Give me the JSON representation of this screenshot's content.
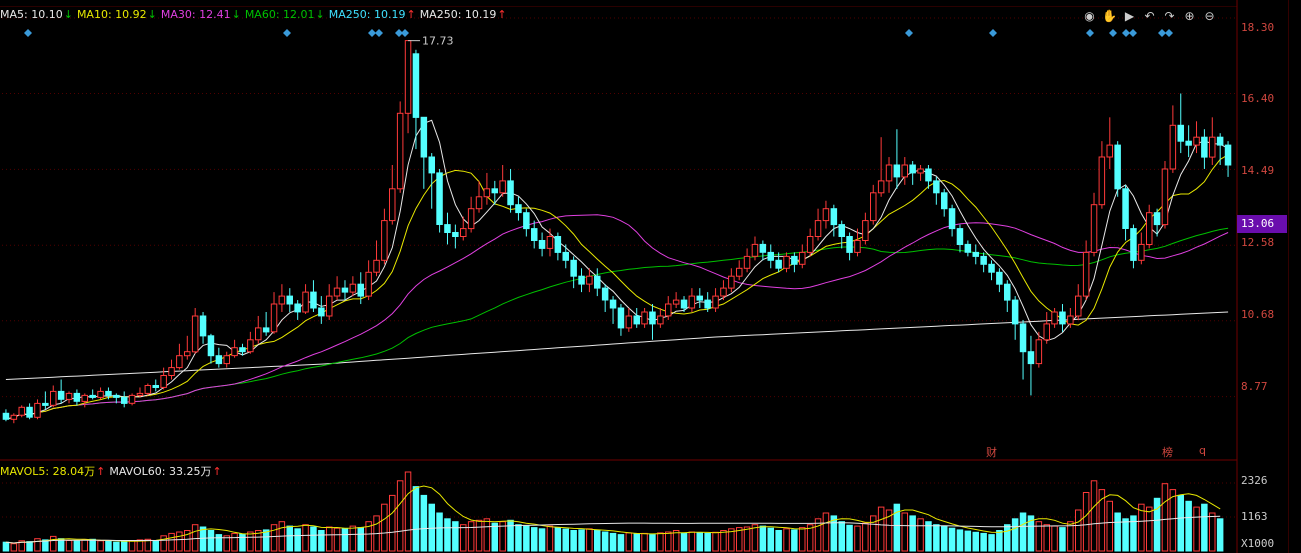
{
  "ma_legend": [
    {
      "text": "MA5: 10.10",
      "arrow": "↓",
      "color": "#e8e8e8",
      "arrow_color": "#00c000"
    },
    {
      "text": "MA10: 10.92",
      "arrow": "↓",
      "color": "#e8e800",
      "arrow_color": "#00c000"
    },
    {
      "text": "MA30: 12.41",
      "arrow": "↓",
      "color": "#e040e0",
      "arrow_color": "#00c000"
    },
    {
      "text": "MA60: 12.01",
      "arrow": "↓",
      "color": "#00c000",
      "arrow_color": "#00c000"
    },
    {
      "text": "MA250: 10.19",
      "arrow": "↑",
      "color": "#40e0ff",
      "arrow_color": "#ff3030"
    },
    {
      "text": "MA250: 10.19",
      "arrow": "↑",
      "color": "#e8e8e8",
      "arrow_color": "#ff3030"
    }
  ],
  "vol_legend": [
    {
      "text": "MAVOL5: 28.04万",
      "arrow": "↑",
      "color": "#e8e800",
      "arrow_color": "#ff3030"
    },
    {
      "text": "MAVOL60: 33.25万",
      "arrow": "↑",
      "color": "#e8e8e8",
      "arrow_color": "#ff3030"
    }
  ],
  "toolbar": [
    {
      "name": "eye-icon",
      "glyph": "◉"
    },
    {
      "name": "hand-icon",
      "glyph": "✋"
    },
    {
      "name": "play-icon",
      "glyph": "▶"
    },
    {
      "name": "undo-icon",
      "glyph": "↶"
    },
    {
      "name": "redo-icon",
      "glyph": "↷"
    },
    {
      "name": "zoom-in-icon",
      "glyph": "⊕"
    },
    {
      "name": "zoom-out-icon",
      "glyph": "⊖"
    }
  ],
  "price_axis": {
    "labels": [
      "18.30",
      "16.40",
      "14.49",
      "12.58",
      "10.68",
      "8.77"
    ],
    "current_price": "13.06"
  },
  "volume_axis": {
    "labels": [
      "2326",
      "1163"
    ],
    "unit": "X1000"
  },
  "max_annotation": "17.73",
  "markers": [
    {
      "text": "财",
      "name": "earnings-marker"
    },
    {
      "text": "榜",
      "name": "ranking-marker"
    },
    {
      "text": "q",
      "name": "q-marker"
    }
  ],
  "colors": {
    "up": "#ff3a3a",
    "down": "#54ffff",
    "ma5": "#e8e8e8",
    "ma10": "#e8e800",
    "ma30": "#e040e0",
    "ma60": "#00c000",
    "ma250": "#e8e8e8",
    "grid": "#500000"
  },
  "chart_data": {
    "type": "candlestick",
    "y_range": [
      7.3,
      18.3
    ],
    "candles": [
      [
        8.35,
        8.2,
        8.45,
        8.15
      ],
      [
        8.2,
        8.3,
        8.35,
        8.1
      ],
      [
        8.3,
        8.5,
        8.55,
        8.25
      ],
      [
        8.5,
        8.25,
        8.6,
        8.2
      ],
      [
        8.25,
        8.6,
        8.7,
        8.2
      ],
      [
        8.6,
        8.55,
        8.9,
        8.45
      ],
      [
        8.55,
        8.9,
        9.05,
        8.5
      ],
      [
        8.9,
        8.7,
        9.2,
        8.6
      ],
      [
        8.7,
        8.85,
        8.9,
        8.6
      ],
      [
        8.85,
        8.65,
        8.95,
        8.55
      ],
      [
        8.65,
        8.8,
        8.85,
        8.5
      ],
      [
        8.8,
        8.75,
        8.95,
        8.7
      ],
      [
        8.75,
        8.9,
        9.0,
        8.7
      ],
      [
        8.9,
        8.8,
        9.0,
        8.7
      ],
      [
        8.8,
        8.75,
        8.85,
        8.6
      ],
      [
        8.75,
        8.6,
        8.9,
        8.5
      ],
      [
        8.6,
        8.8,
        8.85,
        8.55
      ],
      [
        8.8,
        8.85,
        9.0,
        8.75
      ],
      [
        8.85,
        9.05,
        9.1,
        8.8
      ],
      [
        9.05,
        9.0,
        9.2,
        8.9
      ],
      [
        9.0,
        9.3,
        9.5,
        8.95
      ],
      [
        9.3,
        9.5,
        9.7,
        9.2
      ],
      [
        9.5,
        9.8,
        10.1,
        9.45
      ],
      [
        9.8,
        9.9,
        10.3,
        9.7
      ],
      [
        9.9,
        10.8,
        11.0,
        9.85
      ],
      [
        10.8,
        10.3,
        10.9,
        10.1
      ],
      [
        10.3,
        9.8,
        10.35,
        9.6
      ],
      [
        9.8,
        9.6,
        10.0,
        9.5
      ],
      [
        9.6,
        9.8,
        9.9,
        9.5
      ],
      [
        9.8,
        10.0,
        10.2,
        9.75
      ],
      [
        10.0,
        9.9,
        10.1,
        9.8
      ],
      [
        9.9,
        10.2,
        10.4,
        9.85
      ],
      [
        10.2,
        10.5,
        10.8,
        10.1
      ],
      [
        10.5,
        10.4,
        10.9,
        10.3
      ],
      [
        10.4,
        11.1,
        11.4,
        10.35
      ],
      [
        11.1,
        11.3,
        11.6,
        10.9
      ],
      [
        11.3,
        11.1,
        11.5,
        10.9
      ],
      [
        11.1,
        10.9,
        11.2,
        10.7
      ],
      [
        10.9,
        11.4,
        11.6,
        10.85
      ],
      [
        11.4,
        11.0,
        11.7,
        10.9
      ],
      [
        11.0,
        10.8,
        11.3,
        10.6
      ],
      [
        10.8,
        11.3,
        11.6,
        10.7
      ],
      [
        11.3,
        11.5,
        11.8,
        11.2
      ],
      [
        11.5,
        11.4,
        11.7,
        11.2
      ],
      [
        11.4,
        11.6,
        11.8,
        11.3
      ],
      [
        11.6,
        11.3,
        11.9,
        11.1
      ],
      [
        11.3,
        11.9,
        12.2,
        11.2
      ],
      [
        11.9,
        12.2,
        12.7,
        11.8
      ],
      [
        12.2,
        13.2,
        13.5,
        12.1
      ],
      [
        13.2,
        14.0,
        14.6,
        13.1
      ],
      [
        14.0,
        15.9,
        16.2,
        13.9
      ],
      [
        15.9,
        17.73,
        17.73,
        15.4
      ],
      [
        17.4,
        15.8,
        17.5,
        15.0
      ],
      [
        15.8,
        14.8,
        15.1,
        14.0
      ],
      [
        14.8,
        14.4,
        14.9,
        13.5
      ],
      [
        14.4,
        13.1,
        14.5,
        12.9
      ],
      [
        13.1,
        12.9,
        13.4,
        12.6
      ],
      [
        12.9,
        12.8,
        13.1,
        12.5
      ],
      [
        12.8,
        13.0,
        13.3,
        12.7
      ],
      [
        13.0,
        13.5,
        13.8,
        12.9
      ],
      [
        13.5,
        13.8,
        14.2,
        13.4
      ],
      [
        13.8,
        14.0,
        14.4,
        13.6
      ],
      [
        14.0,
        13.9,
        14.2,
        13.6
      ],
      [
        13.9,
        14.2,
        14.6,
        13.8
      ],
      [
        14.2,
        13.6,
        14.5,
        13.4
      ],
      [
        13.6,
        13.4,
        13.8,
        13.2
      ],
      [
        13.4,
        13.0,
        13.5,
        12.8
      ],
      [
        13.0,
        12.7,
        13.2,
        12.5
      ],
      [
        12.7,
        12.5,
        12.9,
        12.3
      ],
      [
        12.5,
        12.8,
        13.0,
        12.3
      ],
      [
        12.8,
        12.4,
        12.9,
        12.2
      ],
      [
        12.4,
        12.2,
        12.6,
        12.0
      ],
      [
        12.2,
        11.8,
        12.3,
        11.5
      ],
      [
        11.8,
        11.6,
        12.0,
        11.4
      ],
      [
        11.6,
        11.8,
        12.0,
        11.4
      ],
      [
        11.8,
        11.5,
        12.0,
        11.3
      ],
      [
        11.5,
        11.2,
        11.6,
        10.9
      ],
      [
        11.2,
        11.0,
        11.3,
        10.6
      ],
      [
        11.0,
        10.5,
        11.1,
        10.3
      ],
      [
        10.5,
        10.8,
        11.0,
        10.4
      ],
      [
        10.8,
        10.6,
        11.0,
        10.5
      ],
      [
        10.6,
        10.9,
        11.0,
        10.5
      ],
      [
        10.9,
        10.6,
        11.1,
        10.2
      ],
      [
        10.6,
        10.8,
        11.0,
        10.5
      ],
      [
        10.8,
        11.1,
        11.3,
        10.7
      ],
      [
        11.1,
        11.2,
        11.4,
        11.0
      ],
      [
        11.2,
        11.0,
        11.3,
        10.9
      ],
      [
        11.0,
        11.3,
        11.5,
        10.9
      ],
      [
        11.3,
        11.2,
        11.5,
        11.0
      ],
      [
        11.2,
        11.0,
        11.4,
        10.9
      ],
      [
        11.0,
        11.3,
        11.5,
        10.9
      ],
      [
        11.3,
        11.5,
        11.7,
        11.2
      ],
      [
        11.5,
        11.8,
        12.0,
        11.4
      ],
      [
        11.8,
        12.0,
        12.2,
        11.7
      ],
      [
        12.0,
        12.3,
        12.5,
        11.9
      ],
      [
        12.3,
        12.6,
        12.8,
        12.2
      ],
      [
        12.6,
        12.4,
        12.7,
        12.2
      ],
      [
        12.4,
        12.2,
        12.6,
        12.0
      ],
      [
        12.2,
        12.0,
        12.4,
        11.9
      ],
      [
        12.0,
        12.3,
        12.4,
        11.9
      ],
      [
        12.3,
        12.1,
        12.4,
        11.9
      ],
      [
        12.1,
        12.4,
        12.6,
        12.0
      ],
      [
        12.4,
        12.8,
        13.0,
        12.3
      ],
      [
        12.8,
        13.2,
        13.5,
        12.7
      ],
      [
        13.2,
        13.5,
        13.7,
        13.0
      ],
      [
        13.5,
        13.1,
        13.6,
        12.8
      ],
      [
        13.1,
        12.8,
        13.2,
        12.5
      ],
      [
        12.8,
        12.4,
        12.9,
        12.2
      ],
      [
        12.4,
        12.7,
        13.0,
        12.3
      ],
      [
        12.7,
        13.2,
        13.4,
        12.6
      ],
      [
        13.2,
        13.9,
        14.1,
        13.1
      ],
      [
        13.9,
        14.2,
        15.3,
        13.8
      ],
      [
        14.2,
        14.6,
        14.8,
        13.9
      ],
      [
        14.6,
        14.3,
        15.5,
        14.0
      ],
      [
        14.3,
        14.6,
        14.8,
        14.1
      ],
      [
        14.6,
        14.4,
        14.7,
        14.1
      ],
      [
        14.4,
        14.5,
        14.6,
        14.2
      ],
      [
        14.5,
        14.2,
        14.6,
        14.0
      ],
      [
        14.2,
        13.9,
        14.3,
        13.6
      ],
      [
        13.9,
        13.5,
        14.0,
        13.3
      ],
      [
        13.5,
        13.0,
        13.6,
        12.8
      ],
      [
        13.0,
        12.6,
        13.1,
        12.4
      ],
      [
        12.6,
        12.4,
        12.7,
        12.3
      ],
      [
        12.4,
        12.3,
        12.6,
        12.1
      ],
      [
        12.3,
        12.1,
        12.4,
        11.9
      ],
      [
        12.1,
        11.9,
        12.2,
        11.7
      ],
      [
        11.9,
        11.6,
        12.0,
        11.4
      ],
      [
        11.6,
        11.2,
        11.7,
        10.9
      ],
      [
        11.2,
        10.6,
        11.3,
        10.2
      ],
      [
        10.6,
        9.9,
        10.7,
        9.2
      ],
      [
        9.9,
        9.6,
        10.3,
        8.8
      ],
      [
        9.6,
        10.2,
        10.4,
        9.5
      ],
      [
        10.2,
        10.6,
        10.9,
        10.1
      ],
      [
        10.6,
        10.9,
        11.0,
        10.5
      ],
      [
        10.9,
        10.6,
        11.1,
        10.4
      ],
      [
        10.6,
        10.8,
        11.0,
        10.5
      ],
      [
        10.8,
        11.3,
        11.6,
        10.7
      ],
      [
        11.3,
        12.4,
        12.7,
        11.2
      ],
      [
        12.4,
        13.6,
        13.9,
        12.3
      ],
      [
        13.6,
        14.8,
        15.2,
        13.5
      ],
      [
        14.8,
        15.1,
        15.8,
        14.5
      ],
      [
        15.1,
        14.0,
        15.2,
        13.8
      ],
      [
        14.0,
        13.0,
        14.1,
        12.7
      ],
      [
        13.0,
        12.2,
        13.1,
        12.0
      ],
      [
        12.2,
        12.6,
        12.9,
        12.1
      ],
      [
        12.6,
        13.4,
        13.6,
        12.5
      ],
      [
        13.4,
        13.1,
        13.5,
        12.8
      ],
      [
        13.1,
        14.5,
        14.7,
        13.0
      ],
      [
        14.5,
        15.6,
        16.1,
        14.4
      ],
      [
        15.6,
        15.2,
        16.4,
        14.9
      ],
      [
        15.2,
        15.1,
        15.6,
        14.8
      ],
      [
        15.1,
        15.3,
        15.7,
        14.9
      ],
      [
        15.3,
        14.8,
        15.5,
        14.5
      ],
      [
        14.8,
        15.3,
        15.8,
        14.6
      ],
      [
        15.3,
        15.1,
        15.4,
        14.6
      ],
      [
        15.1,
        14.6,
        15.2,
        14.3
      ]
    ],
    "volume_range": [
      0,
      2700
    ],
    "volume": [
      300,
      250,
      350,
      320,
      420,
      380,
      500,
      420,
      360,
      340,
      380,
      400,
      350,
      330,
      300,
      320,
      360,
      380,
      400,
      350,
      520,
      600,
      650,
      700,
      900,
      820,
      700,
      560,
      520,
      600,
      580,
      650,
      700,
      720,
      900,
      1000,
      850,
      760,
      900,
      820,
      700,
      820,
      780,
      760,
      850,
      800,
      1000,
      1200,
      1600,
      1900,
      2400,
      2700,
      2200,
      1900,
      1600,
      1300,
      1100,
      1000,
      900,
      1000,
      1050,
      1100,
      950,
      1000,
      1050,
      900,
      850,
      800,
      760,
      850,
      800,
      750,
      700,
      720,
      760,
      700,
      650,
      600,
      560,
      620,
      580,
      600,
      560,
      620,
      650,
      700,
      600,
      650,
      620,
      600,
      640,
      700,
      760,
      800,
      820,
      900,
      850,
      780,
      700,
      760,
      720,
      800,
      900,
      1100,
      1300,
      1200,
      1000,
      880,
      850,
      950,
      1200,
      1500,
      1400,
      1600,
      1300,
      1200,
      1100,
      1000,
      900,
      850,
      780,
      720,
      680,
      640,
      600,
      560,
      700,
      900,
      1100,
      1300,
      1200,
      1000,
      900,
      850,
      800,
      1000,
      1400,
      2000,
      2400,
      2100,
      1700,
      1300,
      1100,
      1200,
      1600,
      1500,
      1800,
      2300,
      2100,
      1900,
      1700,
      1500,
      1600,
      1300,
      1100
    ],
    "moving_averages": [
      "MA5",
      "MA10",
      "MA30",
      "MA60",
      "MA250"
    ],
    "volume_averages": [
      "MAVOL5",
      "MAVOL60"
    ]
  }
}
